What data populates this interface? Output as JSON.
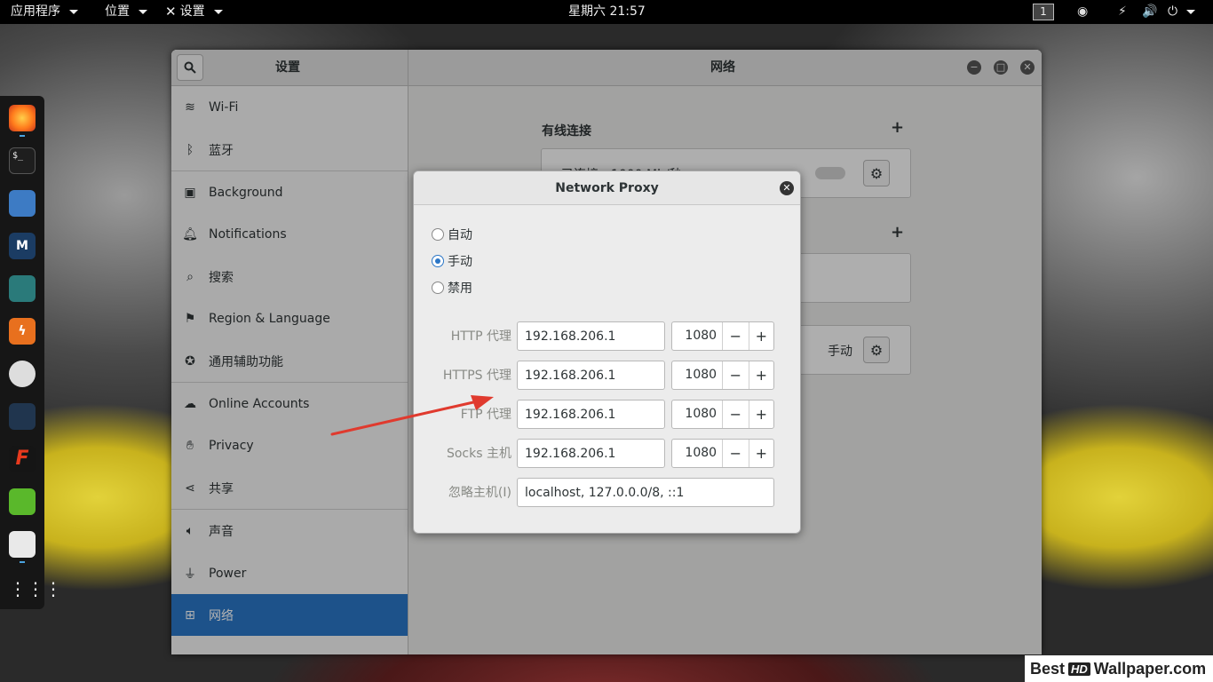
{
  "topbar": {
    "apps_label": "应用程序",
    "places_label": "位置",
    "settings_label": "设置",
    "clock": "星期六 21:57",
    "workspace": "1"
  },
  "dock": {
    "icons": [
      "firefox-icon",
      "terminal-icon",
      "files-icon",
      "metasploit-icon",
      "armitage-icon",
      "burpsuite-icon",
      "maltego-icon",
      "beef-icon",
      "faraday-icon",
      "leafpad-icon",
      "tweaks-icon",
      "show-apps-icon"
    ]
  },
  "settings": {
    "sidebar_title": "设置",
    "main_title": "网络",
    "sidebar": [
      {
        "label": "Wi-Fi",
        "icon": "wifi-icon"
      },
      {
        "label": "蓝牙",
        "icon": "bluetooth-icon"
      },
      {
        "label": "Background",
        "icon": "background-icon"
      },
      {
        "label": "Notifications",
        "icon": "bell-icon"
      },
      {
        "label": "搜索",
        "icon": "search-icon"
      },
      {
        "label": "Region & Language",
        "icon": "flag-icon"
      },
      {
        "label": "通用辅助功能",
        "icon": "accessibility-icon"
      },
      {
        "label": "Online Accounts",
        "icon": "cloud-icon"
      },
      {
        "label": "Privacy",
        "icon": "hand-icon"
      },
      {
        "label": "共享",
        "icon": "share-icon"
      },
      {
        "label": "声音",
        "icon": "speaker-icon"
      },
      {
        "label": "Power",
        "icon": "power-plug-icon"
      },
      {
        "label": "网络",
        "icon": "network-icon"
      }
    ],
    "network": {
      "wired_title": "有线连接",
      "wired_status": "已连接 - 1000 Mb/秒",
      "proxy_mode": "手动"
    }
  },
  "dialog": {
    "title": "Network Proxy",
    "options": [
      "自动",
      "手动",
      "禁用"
    ],
    "selected": "手动",
    "http_label": "HTTP 代理",
    "http_host": "192.168.206.1",
    "http_port": "1080",
    "https_label": "HTTPS 代理",
    "https_host": "192.168.206.1",
    "https_port": "1080",
    "ftp_label": "FTP 代理",
    "ftp_host": "192.168.206.1",
    "ftp_port": "1080",
    "socks_label": "Socks 主机",
    "socks_host": "192.168.206.1",
    "socks_port": "1080",
    "ignore_label": "忽略主机(I)",
    "ignore_hosts": "localhost, 127.0.0.0/8, ::1",
    "minus": "−",
    "plus": "+"
  },
  "watermark": {
    "best": "Best",
    "hd": "HD",
    "rest": "Wallpaper.com"
  },
  "colors": {
    "accent": "#2a76c6",
    "arrow": "#e03a2e"
  }
}
